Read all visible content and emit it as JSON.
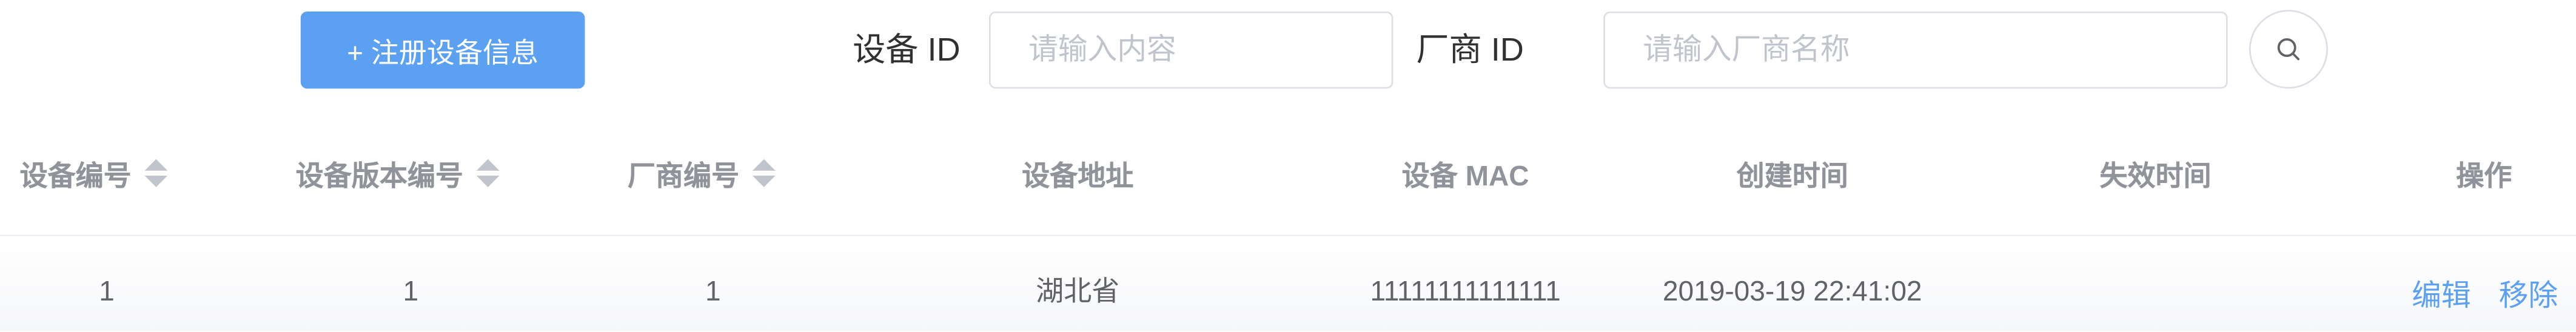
{
  "toolbar": {
    "register_button": "+ 注册设备信息",
    "device_id_label": "设备 ID",
    "device_id_placeholder": "请输入内容",
    "vendor_id_label": "厂商 ID",
    "vendor_id_placeholder": "请输入厂商名称",
    "search_icon": "search-icon"
  },
  "table": {
    "columns": [
      "设备编号",
      "设备版本编号",
      "厂商编号",
      "设备地址",
      "设备 MAC",
      "创建时间",
      "失效时间",
      "操作"
    ],
    "sortable": [
      true,
      true,
      true,
      false,
      false,
      false,
      false,
      false
    ],
    "rows": [
      {
        "device_no": "1",
        "version_no": "1",
        "vendor_no": "1",
        "address": "湖北省",
        "mac": "11111111111111",
        "created": "2019-03-19 22:41:02",
        "expires": "",
        "actions": [
          "编辑",
          "移除"
        ]
      }
    ]
  },
  "colors": {
    "primary": "#5ca0f2",
    "header_text": "#909399",
    "body_text": "#606266",
    "border": "#dcdfe6"
  }
}
